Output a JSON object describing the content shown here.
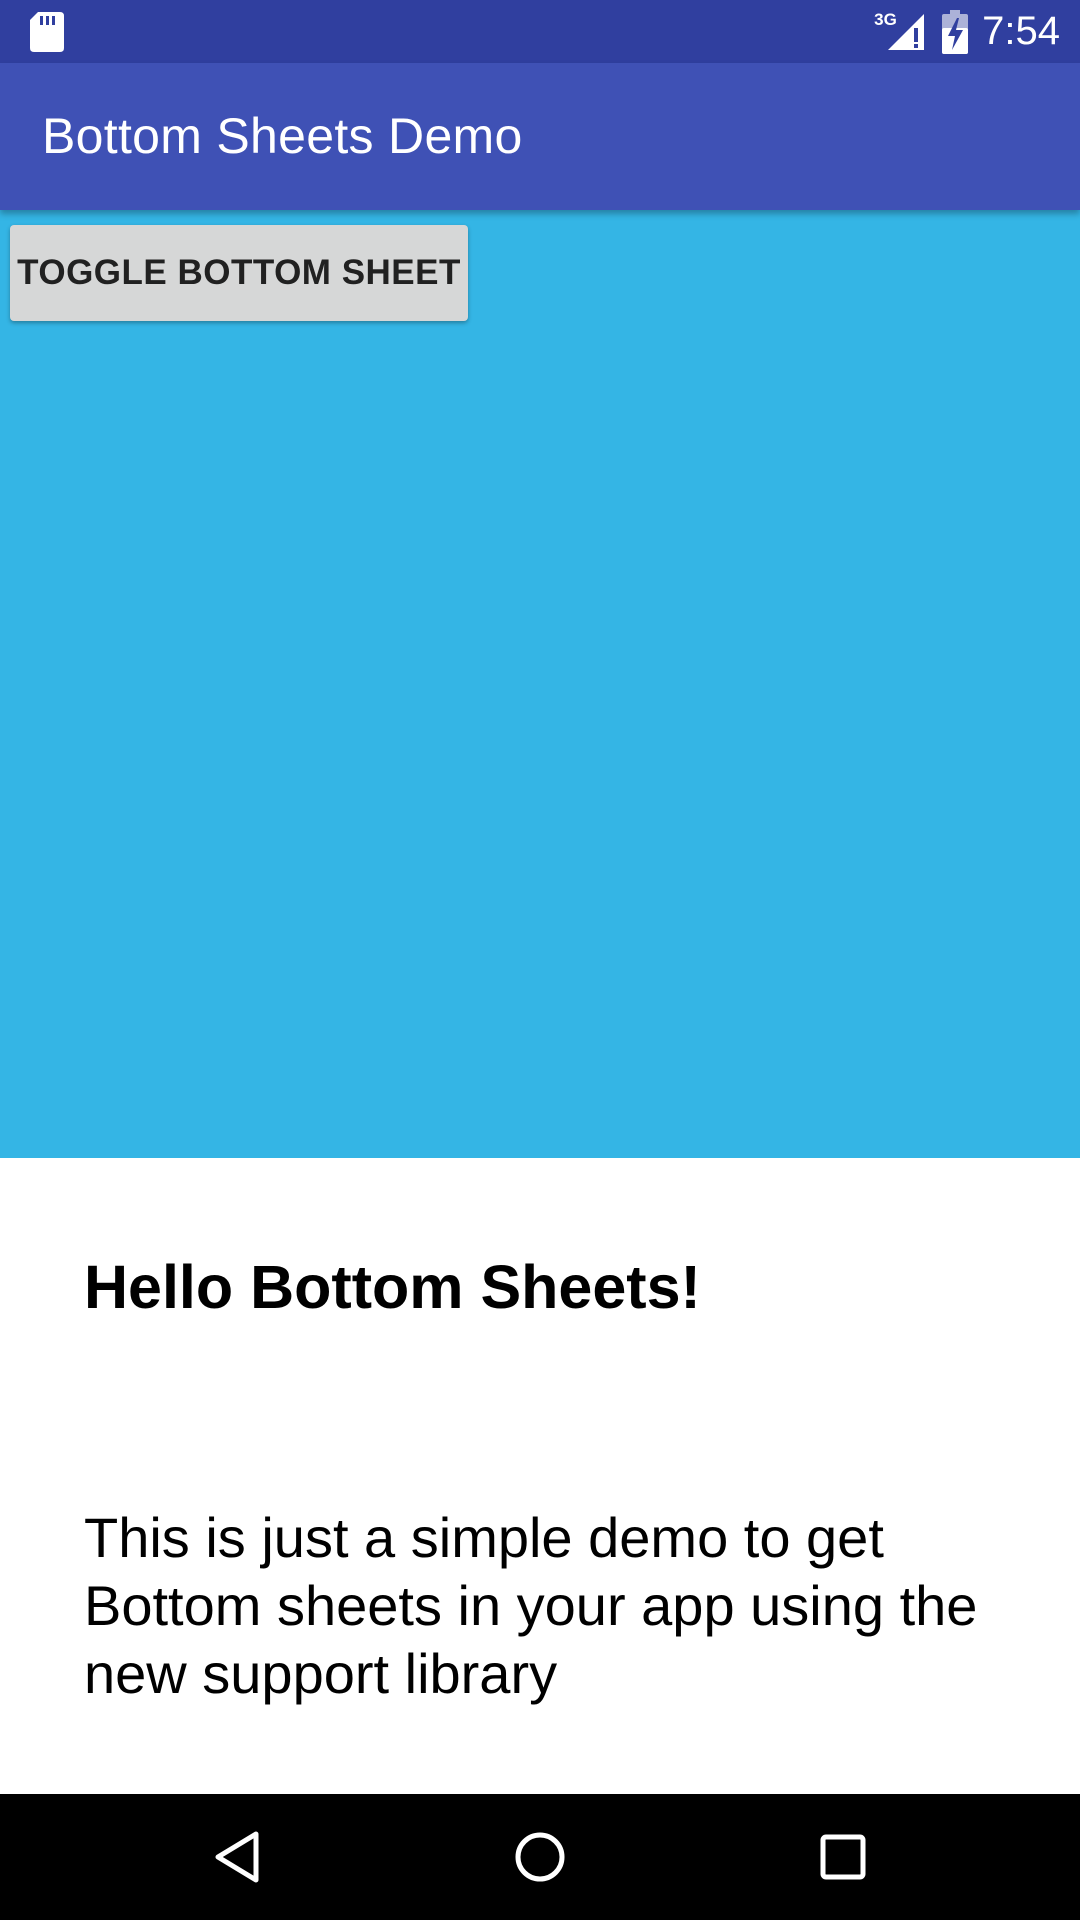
{
  "status_bar": {
    "time": "7:54",
    "network_label": "3G",
    "icons": [
      "sd-card-icon",
      "signal-3g-icon",
      "battery-charging-icon"
    ]
  },
  "app_bar": {
    "title": "Bottom Sheets Demo"
  },
  "main": {
    "toggle_button_label": "TOGGLE BOTTOM SHEET"
  },
  "bottom_sheet": {
    "title": "Hello Bottom Sheets!",
    "body": "This is just a simple demo to get Bottom sheets in your app using the new support library"
  },
  "nav_bar": {
    "icons": [
      "back-icon",
      "home-icon",
      "recents-icon"
    ]
  },
  "colors": {
    "status_bar": "#303f9f",
    "app_bar": "#3f51b5",
    "background": "#34b5e5",
    "button": "#d6d7d7",
    "sheet": "#ffffff",
    "nav_bar": "#000000"
  }
}
